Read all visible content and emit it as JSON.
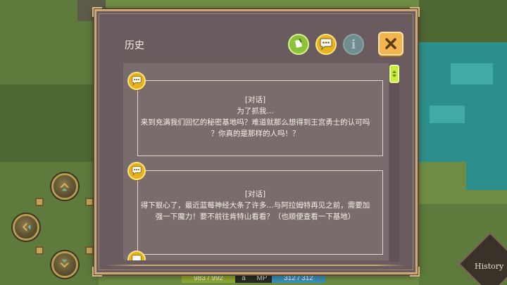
{
  "panel": {
    "title": "历史",
    "header_icons": [
      "note-icon",
      "chat-bubble-icon",
      "info-icon"
    ],
    "info_glyph": "i",
    "close_icon": "close-icon"
  },
  "entries": [
    {
      "icon": "chat-bubble-icon",
      "type": "[对话]",
      "lines": [
        "为了抓我…",
        "来到充满我们回忆的秘密基地吗？难道就那么想得到王宫勇士的认可吗",
        "？你真的是那样的人吗！？"
      ]
    },
    {
      "icon": "chat-bubble-icon",
      "type": "[对话]",
      "lines": [
        "得下狠心了，最近蓝莓神经大条了许多…与阿拉姆特再见之前，需要加",
        "强一下魔力！要不前往肯特山看看？（也顺便查看一下基地）"
      ]
    }
  ],
  "status": {
    "hp_text": "983 / 992",
    "mid_text": "a",
    "mp_label": "MP",
    "mp_text": "312 / 312"
  },
  "history_button": "History",
  "colors": {
    "panel_bg": "#6a5b5e",
    "panel_border": "#cfa877",
    "accent_yellow": "#e7b31c",
    "accent_green": "#8bc23a",
    "close_orange": "#f2b550"
  }
}
